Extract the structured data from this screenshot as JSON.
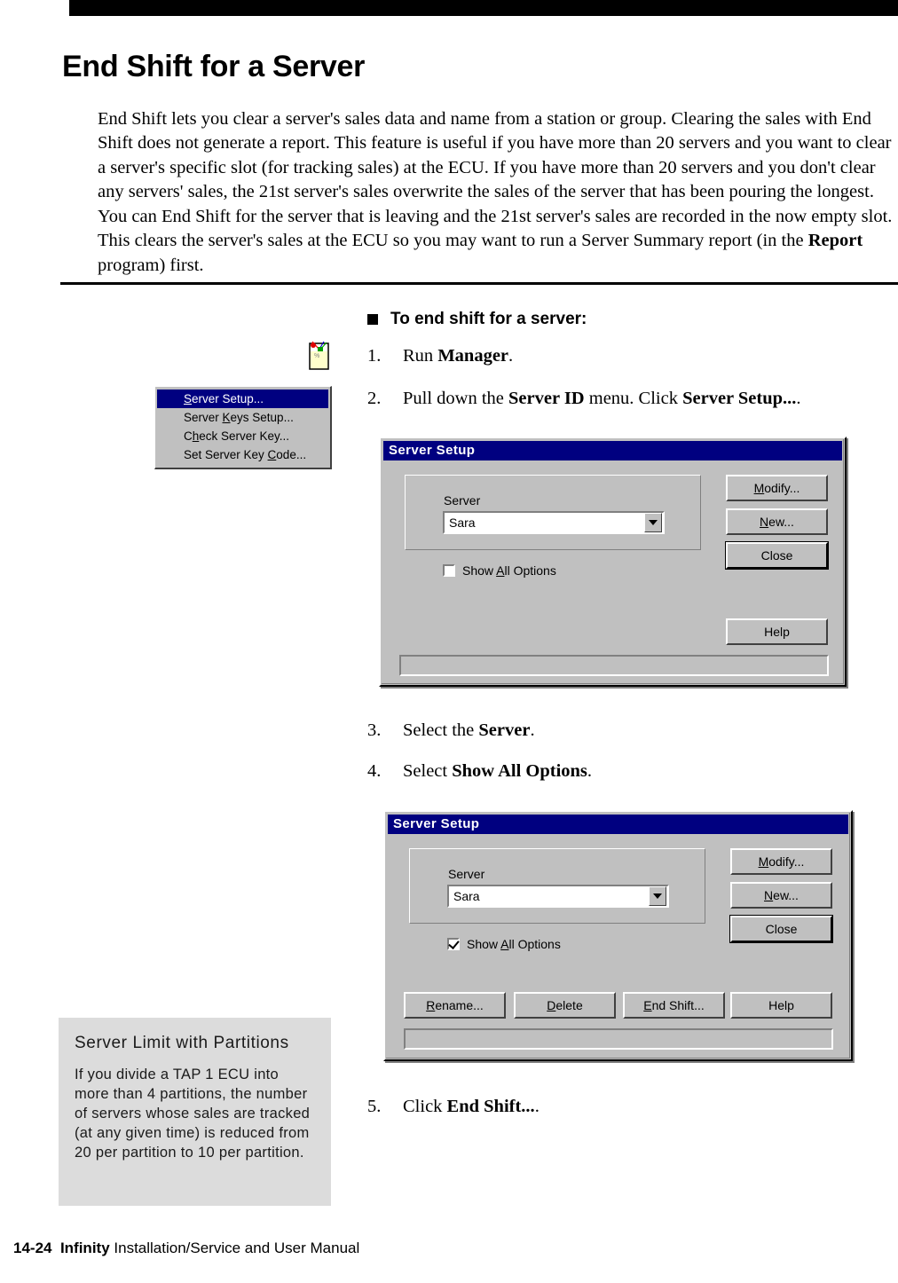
{
  "header": {
    "rule_color": "#000000"
  },
  "page": {
    "title": "End Shift for a Server",
    "intro_part1": "End Shift lets you clear a server's sales data and name from a station or group. Clearing the sales with End Shift does not generate a report. This feature is useful if you have more than 20 servers and you want to clear a server's specific slot (for tracking sales) at the ECU. If you have more than 20 servers and you don't clear any servers' sales, the 21st server's sales overwrite the sales of the server that has been pouring the longest. You can End Shift for the server that is leaving and the 21st server's sales are recorded in the now empty slot. This clears the server's sales at the ECU so you may want to run a Server Summary report (in the ",
    "intro_bold": "Report",
    "intro_part2": " program) first."
  },
  "procedure": {
    "heading": "To end shift for a server:",
    "steps": [
      {
        "num": "1.",
        "pre": "Run ",
        "bold": "Manager",
        "post": "."
      },
      {
        "num": "2.",
        "pre": "Pull down the ",
        "bold": "Server ID",
        "mid": " menu. Click ",
        "bold2": "Server Setup...",
        "post": "."
      },
      {
        "num": "3.",
        "pre": "Select the ",
        "bold": "Server",
        "post": "."
      },
      {
        "num": "4.",
        "pre": "Select ",
        "bold": "Show All Options",
        "post": "."
      },
      {
        "num": "5.",
        "pre": "Click ",
        "bold": "End Shift...",
        "post": "."
      }
    ]
  },
  "server_id_menu": {
    "items": [
      {
        "before": "",
        "key": "S",
        "after": "erver Setup...",
        "selected": true
      },
      {
        "before": "Server ",
        "key": "K",
        "after": "eys Setup...",
        "selected": false
      },
      {
        "before": "C",
        "key": "h",
        "after": "eck Server Key...",
        "selected": false
      },
      {
        "before": "Set Server Key ",
        "key": "C",
        "after": "ode...",
        "selected": false
      }
    ],
    "highlight_color": "#000080"
  },
  "dialog1": {
    "title": "Server Setup",
    "server_label": "Server",
    "server_value": "Sara",
    "checkbox": {
      "before": "Show ",
      "key": "A",
      "after": "ll Options",
      "checked": false
    },
    "buttons": {
      "modify": {
        "before": "",
        "key": "M",
        "after": "odify..."
      },
      "new": {
        "before": "",
        "key": "N",
        "after": "ew..."
      },
      "close": {
        "before": "Close",
        "key": "",
        "after": ""
      },
      "help": {
        "before": "Help",
        "key": "",
        "after": ""
      }
    },
    "titlebar_color": "#000080",
    "face_color": "#c0c0c0"
  },
  "dialog2": {
    "title": "Server Setup",
    "server_label": "Server",
    "server_value": "Sara",
    "checkbox": {
      "before": "Show ",
      "key": "A",
      "after": "ll Options",
      "checked": true
    },
    "buttons": {
      "modify": {
        "before": "",
        "key": "M",
        "after": "odify..."
      },
      "new": {
        "before": "",
        "key": "N",
        "after": "ew..."
      },
      "close": {
        "before": "Close",
        "key": "",
        "after": ""
      },
      "rename": {
        "before": "",
        "key": "R",
        "after": "ename..."
      },
      "delete": {
        "before": "",
        "key": "D",
        "after": "elete"
      },
      "end_shift": {
        "before": "",
        "key": "E",
        "after": "nd Shift..."
      },
      "help": {
        "before": "Help",
        "key": "",
        "after": ""
      }
    },
    "titlebar_color": "#000080",
    "face_color": "#c0c0c0"
  },
  "side_note": {
    "title": "Server Limit with Partitions",
    "body": "If you divide a TAP 1 ECU into more than 4 partitions, the number of servers whose sales are tracked (at any given time) is reduced from 20 per partition to 10 per partition.",
    "background": "#dcdcdc"
  },
  "footer": {
    "page_number": "14-24",
    "brand": "Infinity",
    "manual": "Installation/Service and User Manual"
  }
}
